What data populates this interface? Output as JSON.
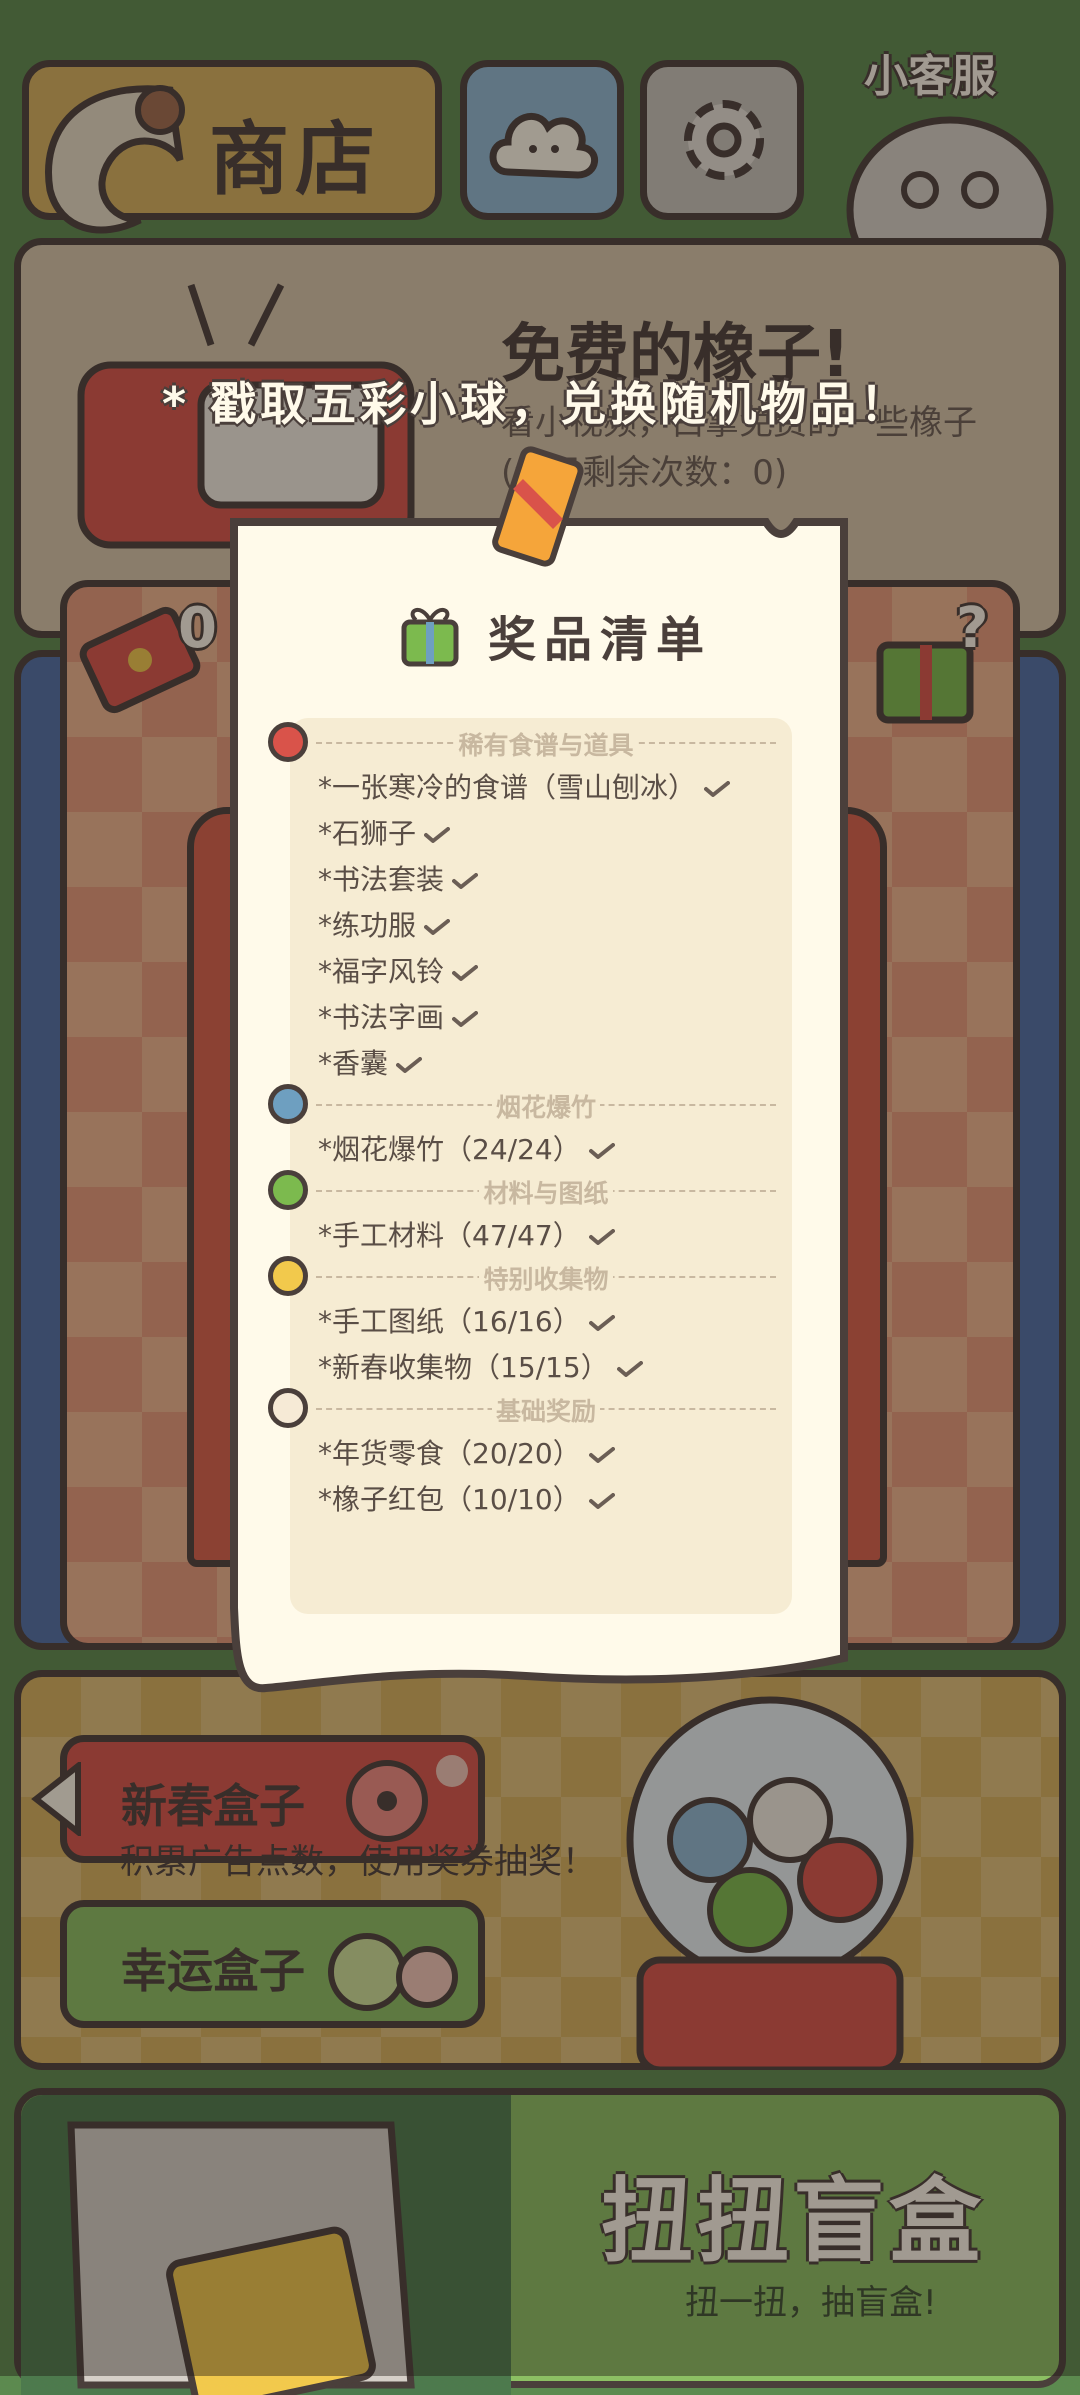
{
  "header": {
    "shop_label": "商店",
    "service_label": "小客服"
  },
  "free_acorn": {
    "title": "免费的橡子!",
    "desc": "看小视频，白拿免费的一些橡子",
    "remaining": "(今日剩余次数：0)"
  },
  "tip_banner": "* 戳取五彩小球，兑换随机物品！",
  "ticket_count": "0",
  "gift_mark": "?",
  "prize_list": {
    "title": "奖品清单",
    "sections": [
      {
        "name": "稀有食谱与道具",
        "ball_color": "#d9534a",
        "items": [
          "*一张寒冷的食谱（雪山刨冰）",
          "*石狮子",
          "*书法套装",
          "*练功服",
          "*福字风铃",
          "*书法字画",
          "*香囊"
        ]
      },
      {
        "name": "烟花爆竹",
        "ball_color": "#6e9fc0",
        "items": [
          "*烟花爆竹（24/24）"
        ]
      },
      {
        "name": "材料与图纸",
        "ball_color": "#7cba4e",
        "items": [
          "*手工材料（47/47）"
        ]
      },
      {
        "name": "特别收集物",
        "ball_color": "#f2c94c",
        "items": [
          "*手工图纸（16/16）",
          "*新春收集物（15/15）"
        ]
      },
      {
        "name": "基础奖励",
        "ball_color": "#f6ead6",
        "items": [
          "*年货零食（20/20）",
          "*橡子红包（10/10）"
        ]
      }
    ]
  },
  "boxes": {
    "spring_box": "新春盒子",
    "lucky_box": "幸运盒子",
    "box_desc": "积累广告点数，使用奖券抽奖！"
  },
  "blind_box": {
    "title": "扭扭盲盒",
    "desc": "扭一扭，抽盲盒!"
  },
  "colors": {
    "paper": "#fffaea",
    "outline": "#4a3f3b",
    "green_bg": "#5c8a4f",
    "shop_tan": "#d7b25e",
    "spring_red": "#d9534a",
    "lucky_green": "#8cc063"
  }
}
